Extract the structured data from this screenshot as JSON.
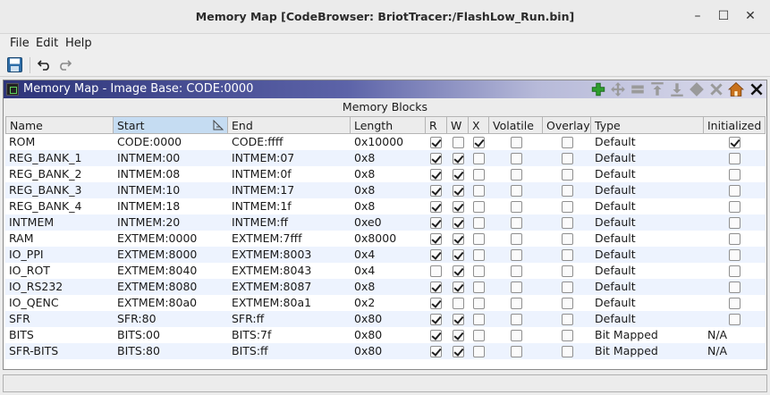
{
  "window": {
    "title": "Memory Map [CodeBrowser: BriotTracer:/FlashLow_Run.bin]",
    "minimize": "–",
    "maximize": "☐",
    "close": "✕"
  },
  "menu": [
    "File",
    "Edit",
    "Help"
  ],
  "toolbar": {
    "save_icon": "save-icon",
    "undo_icon": "undo-icon",
    "redo_icon": "redo-icon"
  },
  "panel": {
    "title": "Memory Map - Image Base: CODE:0000",
    "section_label": "Memory Blocks",
    "buttons": [
      "add-block-icon",
      "move-block-icon",
      "split-block-icon",
      "expand-up-icon",
      "expand-down-icon",
      "merge-blocks-icon",
      "delete-block-icon",
      "set-image-base-icon",
      "close-panel-icon"
    ]
  },
  "colors": {
    "accent": "#2d3479",
    "alt_row": "#edf3fe",
    "add_icon": "#2e9e2e",
    "home_icon": "#c8711d"
  },
  "table": {
    "columns": [
      "Name",
      "Start",
      "End",
      "Length",
      "R",
      "W",
      "X",
      "Volatile",
      "Overlay",
      "Type",
      "Initialized"
    ],
    "sorted_column": "Start",
    "rows": [
      {
        "name": "ROM",
        "start": "CODE:0000",
        "end": "CODE:ffff",
        "length": "0x10000",
        "r": true,
        "w": false,
        "x": true,
        "volatile": false,
        "overlay": false,
        "type": "Default",
        "initialized": true
      },
      {
        "name": "REG_BANK_1",
        "start": "INTMEM:00",
        "end": "INTMEM:07",
        "length": "0x8",
        "r": true,
        "w": true,
        "x": false,
        "volatile": false,
        "overlay": false,
        "type": "Default",
        "initialized": false
      },
      {
        "name": "REG_BANK_2",
        "start": "INTMEM:08",
        "end": "INTMEM:0f",
        "length": "0x8",
        "r": true,
        "w": true,
        "x": false,
        "volatile": false,
        "overlay": false,
        "type": "Default",
        "initialized": false
      },
      {
        "name": "REG_BANK_3",
        "start": "INTMEM:10",
        "end": "INTMEM:17",
        "length": "0x8",
        "r": true,
        "w": true,
        "x": false,
        "volatile": false,
        "overlay": false,
        "type": "Default",
        "initialized": false
      },
      {
        "name": "REG_BANK_4",
        "start": "INTMEM:18",
        "end": "INTMEM:1f",
        "length": "0x8",
        "r": true,
        "w": true,
        "x": false,
        "volatile": false,
        "overlay": false,
        "type": "Default",
        "initialized": false
      },
      {
        "name": "INTMEM",
        "start": "INTMEM:20",
        "end": "INTMEM:ff",
        "length": "0xe0",
        "r": true,
        "w": true,
        "x": false,
        "volatile": false,
        "overlay": false,
        "type": "Default",
        "initialized": false
      },
      {
        "name": "RAM",
        "start": "EXTMEM:0000",
        "end": "EXTMEM:7fff",
        "length": "0x8000",
        "r": true,
        "w": true,
        "x": false,
        "volatile": false,
        "overlay": false,
        "type": "Default",
        "initialized": false
      },
      {
        "name": "IO_PPI",
        "start": "EXTMEM:8000",
        "end": "EXTMEM:8003",
        "length": "0x4",
        "r": true,
        "w": true,
        "x": false,
        "volatile": false,
        "overlay": false,
        "type": "Default",
        "initialized": false
      },
      {
        "name": "IO_ROT",
        "start": "EXTMEM:8040",
        "end": "EXTMEM:8043",
        "length": "0x4",
        "r": false,
        "w": true,
        "x": false,
        "volatile": false,
        "overlay": false,
        "type": "Default",
        "initialized": false
      },
      {
        "name": "IO_RS232",
        "start": "EXTMEM:8080",
        "end": "EXTMEM:8087",
        "length": "0x8",
        "r": true,
        "w": true,
        "x": false,
        "volatile": false,
        "overlay": false,
        "type": "Default",
        "initialized": false
      },
      {
        "name": "IO_QENC",
        "start": "EXTMEM:80a0",
        "end": "EXTMEM:80a1",
        "length": "0x2",
        "r": true,
        "w": false,
        "x": false,
        "volatile": false,
        "overlay": false,
        "type": "Default",
        "initialized": false
      },
      {
        "name": "SFR",
        "start": "SFR:80",
        "end": "SFR:ff",
        "length": "0x80",
        "r": true,
        "w": true,
        "x": false,
        "volatile": false,
        "overlay": false,
        "type": "Default",
        "initialized": false
      },
      {
        "name": "BITS",
        "start": "BITS:00",
        "end": "BITS:7f",
        "length": "0x80",
        "r": true,
        "w": true,
        "x": false,
        "volatile": false,
        "overlay": false,
        "type": "Bit Mapped",
        "initialized": "N/A"
      },
      {
        "name": "SFR-BITS",
        "start": "BITS:80",
        "end": "BITS:ff",
        "length": "0x80",
        "r": true,
        "w": true,
        "x": false,
        "volatile": false,
        "overlay": false,
        "type": "Bit Mapped",
        "initialized": "N/A"
      }
    ]
  },
  "status": {
    "text": ""
  }
}
